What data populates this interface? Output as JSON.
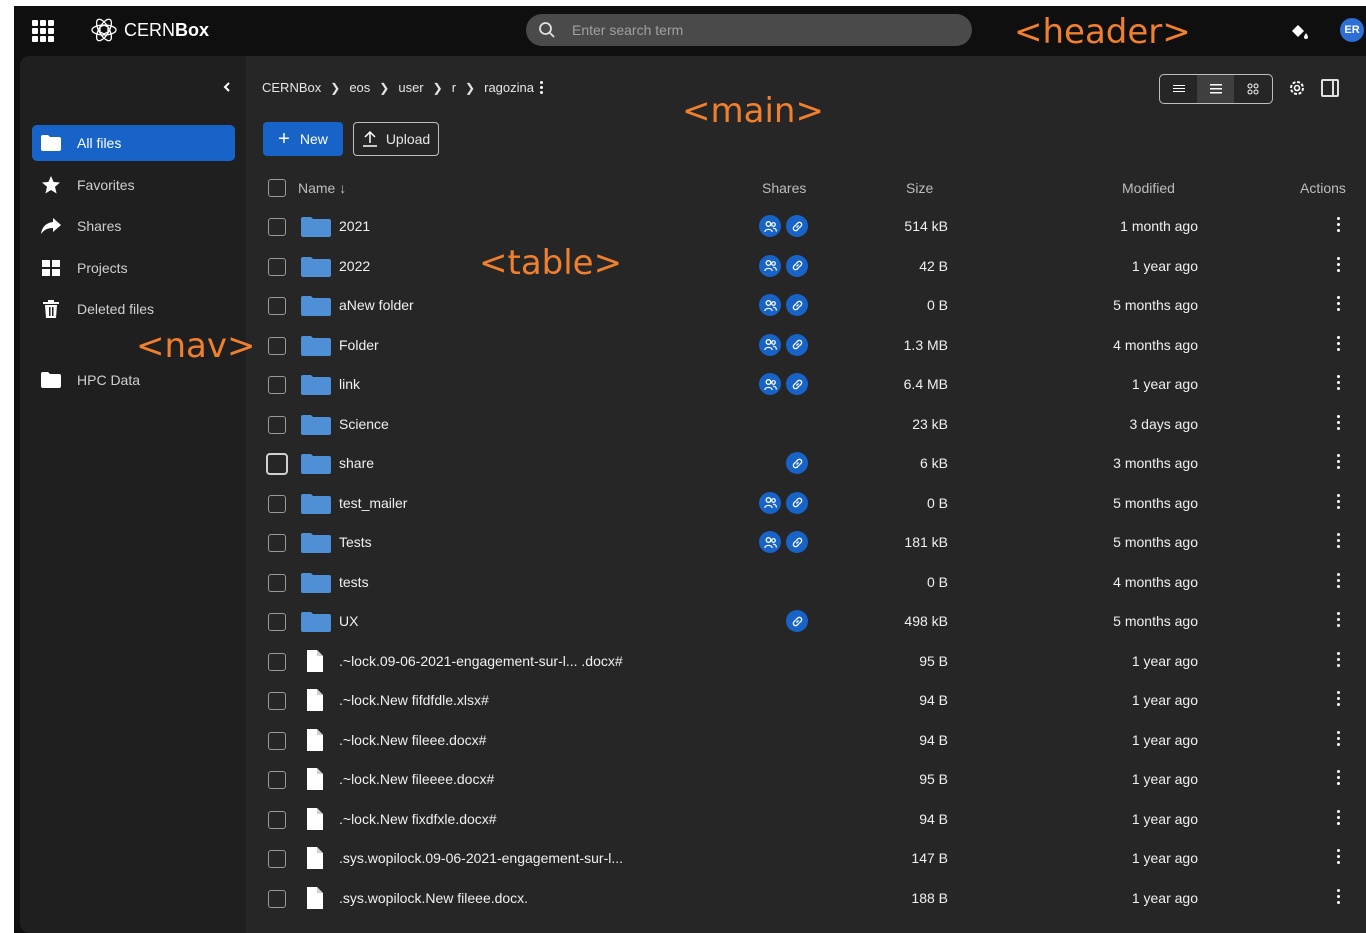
{
  "annotations": {
    "header": "<header>",
    "main": "<main>",
    "table": "<table>",
    "nav": "<nav>"
  },
  "header": {
    "logo_prefix": "CERN",
    "logo_bold": "Box",
    "search_placeholder": "Enter search term",
    "avatar_initials": "ER"
  },
  "nav": {
    "items": [
      {
        "label": "All files",
        "icon": "folder-icon",
        "active": true
      },
      {
        "label": "Favorites",
        "icon": "star-icon"
      },
      {
        "label": "Shares",
        "icon": "share-arrow-icon"
      },
      {
        "label": "Projects",
        "icon": "grid-icon"
      },
      {
        "label": "Deleted files",
        "icon": "trash-icon"
      },
      {
        "label": "HPC Data",
        "icon": "folder-icon"
      }
    ]
  },
  "breadcrumb": [
    "CERNBox",
    "eos",
    "user",
    "r",
    "ragozina"
  ],
  "toolbar": {
    "new_label": "New",
    "upload_label": "Upload"
  },
  "table": {
    "headers": {
      "name": "Name ↓",
      "shares": "Shares",
      "size": "Size",
      "modified": "Modified",
      "actions": "Actions"
    },
    "rows": [
      {
        "name": "2021",
        "type": "folder",
        "shares": [
          "people",
          "link"
        ],
        "size": "514 kB",
        "modified": "1 month ago"
      },
      {
        "name": "2022",
        "type": "folder",
        "shares": [
          "people",
          "link"
        ],
        "size": "42 B",
        "modified": "1 year ago"
      },
      {
        "name": "aNew folder",
        "type": "folder",
        "shares": [
          "people",
          "link"
        ],
        "size": "0 B",
        "modified": "5 months ago"
      },
      {
        "name": "Folder",
        "type": "folder",
        "shares": [
          "people",
          "link"
        ],
        "size": "1.3 MB",
        "modified": "4 months ago"
      },
      {
        "name": "link",
        "type": "folder",
        "shares": [
          "people",
          "link"
        ],
        "size": "6.4 MB",
        "modified": "1 year ago"
      },
      {
        "name": "Science",
        "type": "folder",
        "shares": [],
        "size": "23 kB",
        "modified": "3 days ago"
      },
      {
        "name": "share",
        "type": "folder",
        "shares": [
          "link"
        ],
        "size": "6 kB",
        "modified": "3 months ago",
        "focused": true
      },
      {
        "name": "test_mailer",
        "type": "folder",
        "shares": [
          "people",
          "link"
        ],
        "size": "0 B",
        "modified": "5 months ago"
      },
      {
        "name": "Tests",
        "type": "folder",
        "shares": [
          "people",
          "link"
        ],
        "size": "181 kB",
        "modified": "5 months ago"
      },
      {
        "name": "tests",
        "type": "folder",
        "shares": [],
        "size": "0 B",
        "modified": "4 months ago"
      },
      {
        "name": "UX",
        "type": "folder",
        "shares": [
          "link"
        ],
        "size": "498 kB",
        "modified": "5 months ago"
      },
      {
        "name": ".~lock.09-06-2021-engagement-sur-l... .docx#",
        "type": "file",
        "shares": [],
        "size": "95 B",
        "modified": "1 year ago"
      },
      {
        "name": ".~lock.New fifdfdle.xlsx#",
        "type": "file",
        "shares": [],
        "size": "94 B",
        "modified": "1 year ago"
      },
      {
        "name": ".~lock.New fileee.docx#",
        "type": "file",
        "shares": [],
        "size": "94 B",
        "modified": "1 year ago"
      },
      {
        "name": ".~lock.New fileeee.docx#",
        "type": "file",
        "shares": [],
        "size": "95 B",
        "modified": "1 year ago"
      },
      {
        "name": ".~lock.New fixdfxle.docx#",
        "type": "file",
        "shares": [],
        "size": "94 B",
        "modified": "1 year ago"
      },
      {
        "name": ".sys.wopilock.09-06-2021-engagement-sur-l...",
        "type": "file",
        "shares": [],
        "size": "147 B",
        "modified": "1 year ago"
      },
      {
        "name": ".sys.wopilock.New fileee.docx.",
        "type": "file",
        "shares": [],
        "size": "188 B",
        "modified": "1 year ago"
      }
    ]
  },
  "colors": {
    "accent": "#1863c8",
    "annotation": "#f07f2e",
    "folder": "#4f8fd6",
    "background": "#262626"
  }
}
